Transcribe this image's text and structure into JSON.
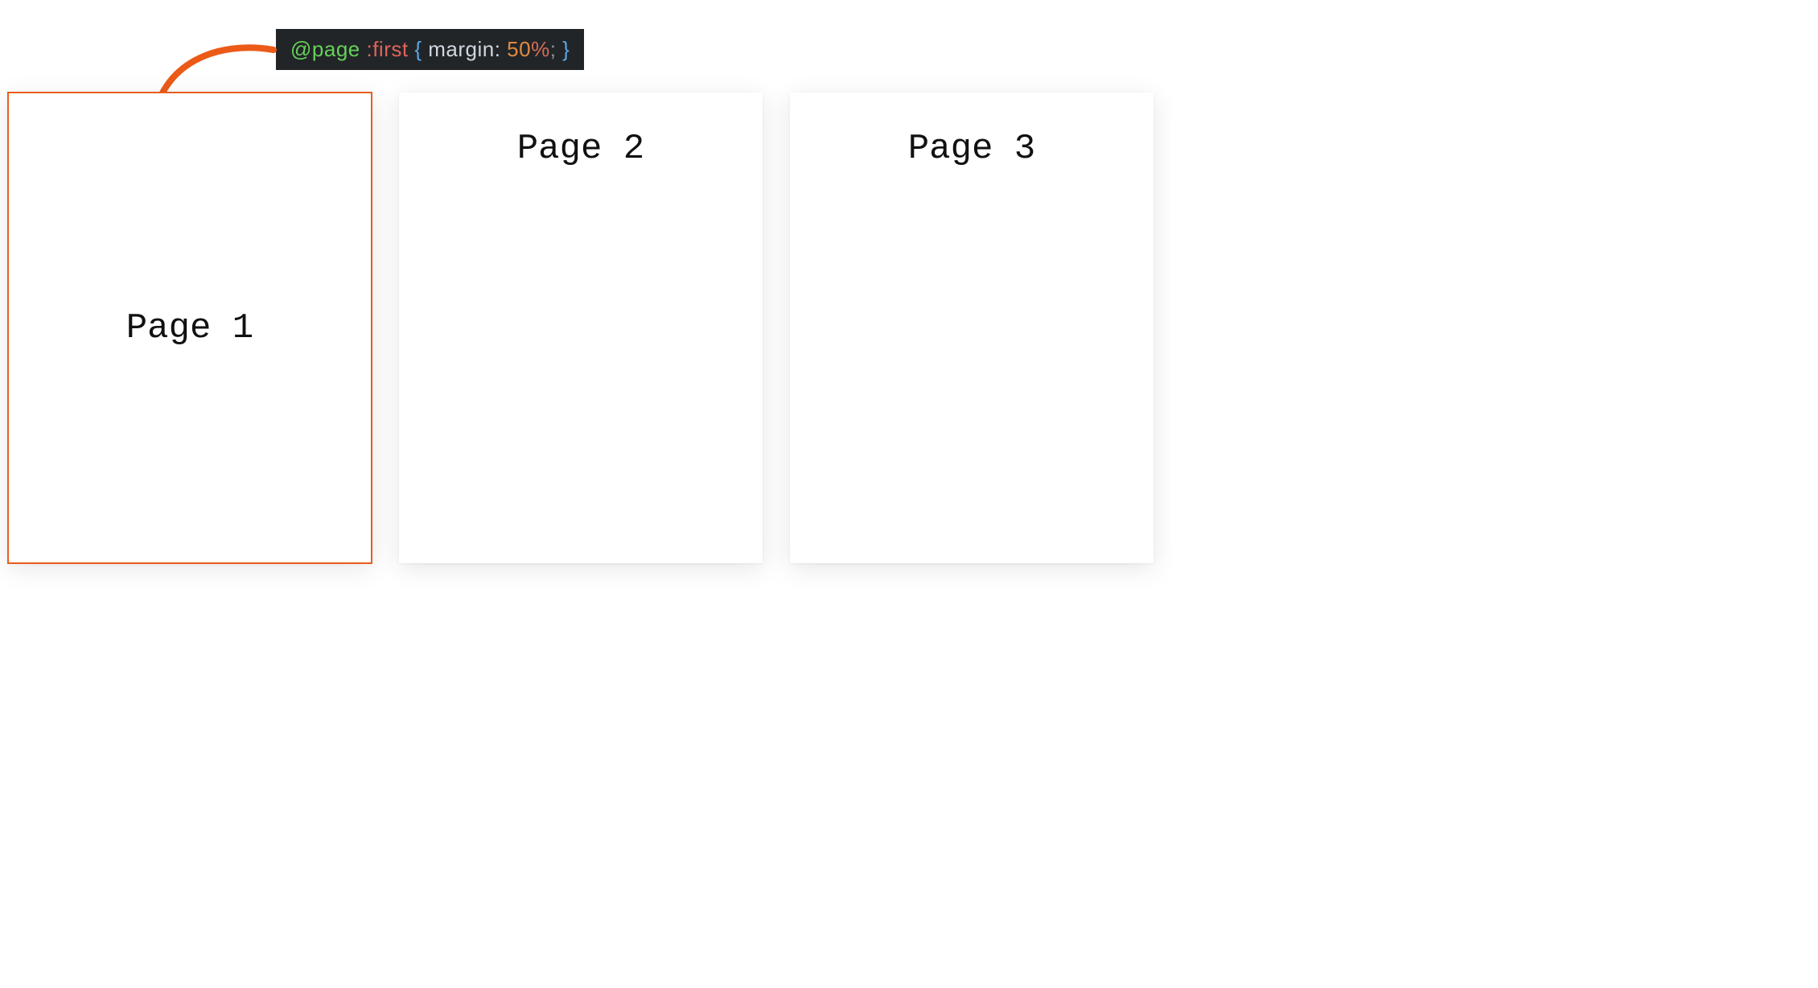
{
  "code": {
    "atrule": "@page ",
    "pseudo": ":first ",
    "open_bracket": "{ ",
    "property": "margin",
    "colon": ": ",
    "value": "50",
    "unit": "%",
    "semicolon": "; ",
    "close_bracket": "}"
  },
  "pages": {
    "page1": "Page 1",
    "page2": "Page 2",
    "page3": "Page 3"
  },
  "colors": {
    "arrow": "#ec5a18",
    "code_bg": "#222528",
    "highlight_border": "#e85d1f"
  }
}
